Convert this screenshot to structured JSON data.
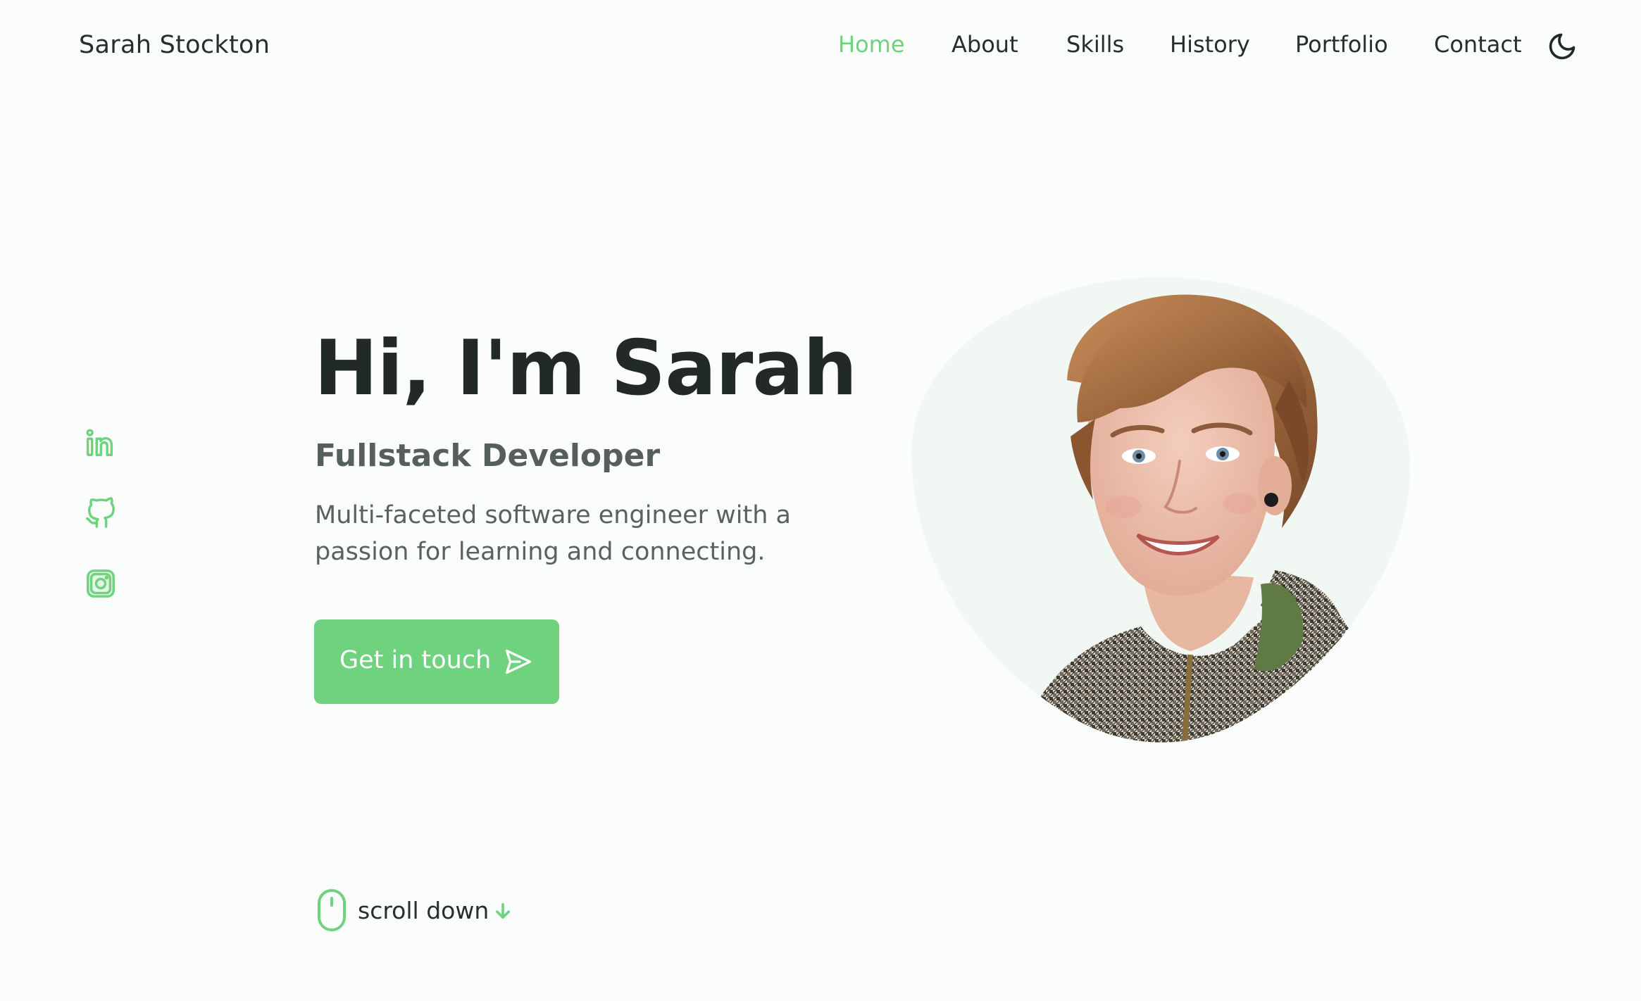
{
  "header": {
    "logo": "Sarah Stockton",
    "nav": [
      {
        "label": "Home",
        "active": true
      },
      {
        "label": "About",
        "active": false
      },
      {
        "label": "Skills",
        "active": false
      },
      {
        "label": "History",
        "active": false
      },
      {
        "label": "Portfolio",
        "active": false
      },
      {
        "label": "Contact",
        "active": false
      }
    ],
    "theme_toggle_icon": "moon-icon"
  },
  "social": [
    {
      "icon": "linkedin-icon"
    },
    {
      "icon": "github-icon"
    },
    {
      "icon": "instagram-icon"
    }
  ],
  "hero": {
    "title": "Hi, I'm Sarah",
    "subtitle": "Fullstack Developer",
    "description": "Multi-faceted software engineer with a passion for learning and connecting.",
    "cta_label": "Get in touch",
    "cta_icon": "send-icon",
    "portrait_icon": "profile-portrait"
  },
  "scroll": {
    "label": "scroll down",
    "icon": "mouse-icon",
    "arrow_icon": "arrow-down-icon"
  },
  "colors": {
    "accent": "#6fd27f",
    "background": "#fafdfb",
    "text": "#222a26",
    "muted": "#5a625e"
  }
}
